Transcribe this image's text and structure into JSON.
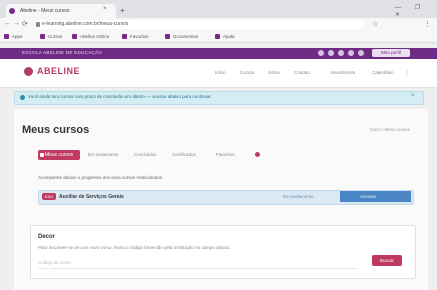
{
  "browser": {
    "tab_title": "Abeline - Meus cursos",
    "new_tab_glyph": "+",
    "tab_close_glyph": "×",
    "window_controls": "— ❐ ✕",
    "url": "e-learning.abeline.com.br/meus-cursos",
    "nav": {
      "back": "←",
      "forward": "→",
      "reload": "⟳",
      "star": "☆",
      "menu": "⋮"
    },
    "bookmarks": [
      "Apps",
      "Cursos",
      "Abeline Online",
      "Favoritos",
      "Documentos",
      "Ajuda"
    ]
  },
  "site": {
    "top_strip_text": "ESCOLA ABELINE DE EDUCAÇÃO",
    "top_strip_button": "Meu perfil",
    "logo_text": "ABELINE",
    "menu": [
      "Início",
      "Cursos",
      "Sobre",
      "Contato",
      "Atendimento",
      "Calendário"
    ],
    "menu_more_glyph": "⋮"
  },
  "notice": {
    "text": "Você ainda tem cursos com prazo de conclusão em aberto — acesse abaixo para continuar.",
    "close_glyph": "×"
  },
  "page": {
    "title": "Meus cursos",
    "breadcrumb": "Início / Meus cursos",
    "tabs": [
      "Meus cursos",
      "Em andamento",
      "Concluídos",
      "Certificados",
      "Favoritos"
    ],
    "description": "Acompanhe abaixo o progresso dos seus cursos matriculados.",
    "course": {
      "badge": "EAD",
      "name": "Auxiliar de Serviços Gerais",
      "status": "Em andamento",
      "progress_label": "Acessar",
      "progress_fraction": 0.19
    },
    "decor": {
      "title": "Decor",
      "text": "Para inscrever-se em um novo curso, insira o código fornecido pela instituição no campo abaixo.",
      "input_placeholder": "Código do curso",
      "button_label": "Buscar"
    }
  },
  "colors": {
    "brand_purple": "#6d2b84",
    "accent_pink": "#c0395f",
    "notice_blue": "#d4ecf3",
    "progress_blue": "#4a86c5"
  }
}
